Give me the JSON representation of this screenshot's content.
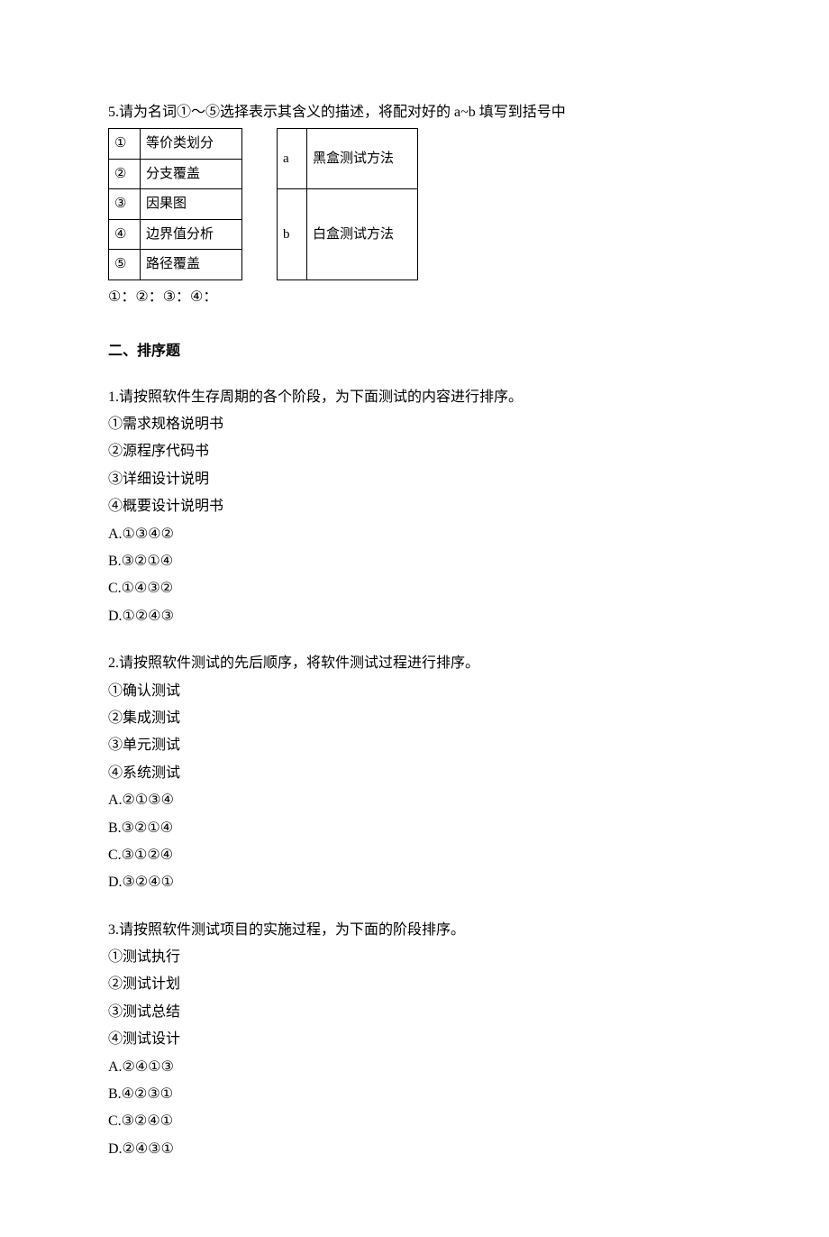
{
  "q5": {
    "prompt": "5.请为名词①～⑤选择表示其含义的描述，将配对好的 a~b 填写到括号中",
    "left": [
      {
        "num": "①",
        "term": "等价类划分"
      },
      {
        "num": "②",
        "term": "分支覆盖"
      },
      {
        "num": "③",
        "term": "因果图"
      },
      {
        "num": "④",
        "term": "边界值分析"
      },
      {
        "num": "⑤",
        "term": "路径覆盖"
      }
    ],
    "right": [
      {
        "letter": "a",
        "desc": "黑盒测试方法"
      },
      {
        "letter": "b",
        "desc": "白盒测试方法"
      }
    ],
    "answer_line": "①：②：③：④："
  },
  "section2_title": "二、排序题",
  "q1": {
    "prompt": "1.请按照软件生存周期的各个阶段，为下面测试的内容进行排序。",
    "items": [
      "①需求规格说明书",
      "②源程序代码书",
      "③详细设计说明",
      "④概要设计说明书"
    ],
    "options": [
      "A.①③④②",
      "B.③②①④",
      "C.①④③②",
      "D.①②④③"
    ]
  },
  "q2": {
    "prompt": "2.请按照软件测试的先后顺序，将软件测试过程进行排序。",
    "items": [
      "①确认测试",
      "②集成测试",
      "③单元测试",
      "④系统测试"
    ],
    "options": [
      "A.②①③④",
      "B.③②①④",
      "C.③①②④",
      "D.③②④①"
    ]
  },
  "q3": {
    "prompt": "3.请按照软件测试项目的实施过程，为下面的阶段排序。",
    "items": [
      "①测试执行",
      "②测试计划",
      "③测试总结",
      "④测试设计"
    ],
    "options": [
      "A.②④①③",
      "B.④②③①",
      "C.③②④①",
      "D.②④③①"
    ]
  }
}
